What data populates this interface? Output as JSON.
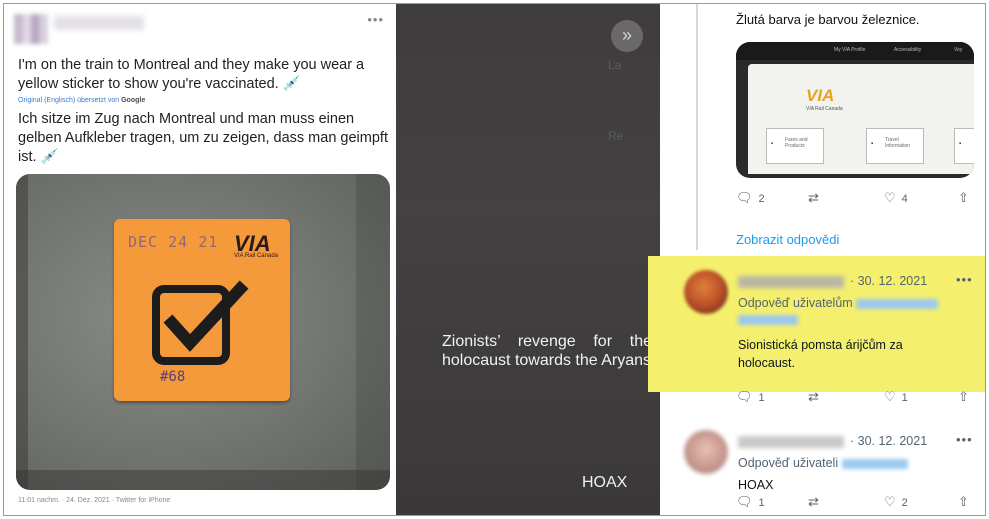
{
  "left_tweet": {
    "text_en": "I'm on the train to Montreal and they make you wear a yellow sticker to show you're vaccinated. 💉",
    "translated_prefix": "Original (Englisch) übersetzt von",
    "translated_brand": "Google",
    "text_de": "Ich sitze im Zug nach Montreal und man muss einen gelben Aufkleber tragen, um zu zeigen, dass man geimpft ist. 💉",
    "sticker_date": "DEC 24 21",
    "sticker_logo": "VIA",
    "sticker_logo_sub": "VIA Rail Canada",
    "sticker_number": "#68",
    "footer": "11:01 nachm. · 24. Dez. 2021 · Twitter for iPhone",
    "more_icon": "more-horizontal-icon"
  },
  "middle": {
    "caption": "Zionists’ revenge for the holocaust towards the Aryans",
    "hoax_label": "HOAX",
    "arrow_icon": "double-chevron-right-icon",
    "ghost_text_1": "La",
    "ghost_text_2": "Re"
  },
  "right_thread": {
    "top_text": "Žlutá barva je barvou železnice.",
    "card": {
      "bar_labels": [
        "My VIA Profile",
        "Accessibility",
        "Voy"
      ],
      "logo": "VIA",
      "logo_sub": "VIA Rail Canada",
      "tiles": [
        "Fares and Products",
        "Travel Information",
        ""
      ]
    },
    "top_actions": {
      "reply_count": "2",
      "like_count": "4"
    },
    "show_replies": "Zobrazit odpovědi",
    "reply1": {
      "date": "· 30. 12. 2021",
      "replying_prefix": "Odpověď uživatelům",
      "body": "Sionistická pomsta árijčům za holocaust.",
      "reply_count": "1",
      "like_count": "1"
    },
    "reply2": {
      "date": "· 30. 12. 2021",
      "replying_prefix": "Odpověď uživateli",
      "body": "HOAX",
      "reply_count": "1",
      "like_count": "2"
    }
  },
  "colors": {
    "highlight": "#f4ef6d",
    "link": "#1d9bf0",
    "sticker": "#f59a3a",
    "dark_panel": "#3e3c3d"
  }
}
